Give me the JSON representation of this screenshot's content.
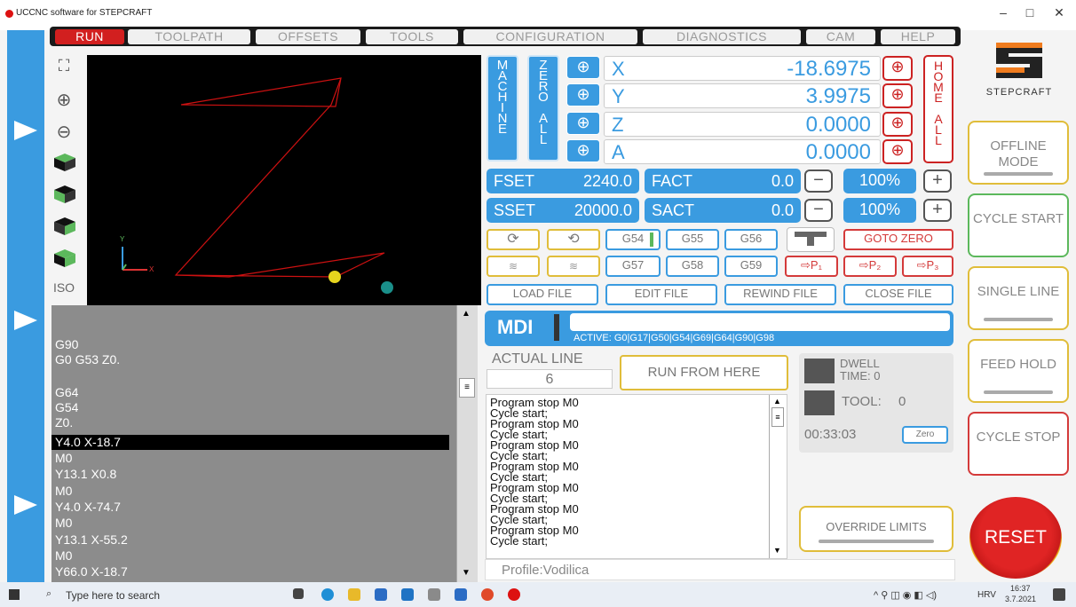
{
  "window": {
    "title": "UCCNC software for STEPCRAFT",
    "min": "–",
    "max": "□",
    "close": "✕"
  },
  "tabs": [
    "RUN",
    "TOOLPATH",
    "OFFSETS",
    "TOOLS",
    "CONFIGURATION",
    "DIAGNOSTICS",
    "CAM",
    "HELP"
  ],
  "view_tools": {
    "fit": "⛶",
    "zoom_in": "⊕",
    "zoom_out": "⊖",
    "iso": "ISO"
  },
  "viewport_axes": {
    "y": "Y",
    "x": "X"
  },
  "gcode": {
    "lines": [
      "",
      "",
      "G90",
      "G0 G53 Z0.",
      "",
      "G64",
      "G54",
      "Z0.",
      "Y4.0 X-18.7",
      "M0",
      "Y13.1 X0.8",
      "M0",
      "Y4.0 X-74.7",
      "M0",
      "Y13.1 X-55.2",
      "M0",
      "Y66.0 X-18.7"
    ],
    "selected_index": 8
  },
  "dro": {
    "machine_label": [
      "M",
      "A",
      "C",
      "H",
      "I",
      "N",
      "E"
    ],
    "zero_all_label": [
      "Z",
      "E",
      "R",
      "O",
      "",
      "A",
      "L",
      "L"
    ],
    "home_all_label": [
      "H",
      "O",
      "M",
      "E",
      "",
      "A",
      "L",
      "L"
    ],
    "axes": [
      {
        "name": "X",
        "value": "-18.6975"
      },
      {
        "name": "Y",
        "value": "3.9975"
      },
      {
        "name": "Z",
        "value": "0.0000"
      },
      {
        "name": "A",
        "value": "0.0000"
      }
    ],
    "plus_symbol": "⊕",
    "home_symbol": "⊕"
  },
  "feed": {
    "fset_label": "FSET",
    "fset_value": "2240.0",
    "fact_label": "FACT",
    "fact_value": "0.0",
    "override": "100%"
  },
  "spindle": {
    "sset_label": "SSET",
    "sset_value": "20000.0",
    "sact_label": "SACT",
    "sact_value": "0.0",
    "override": "100%"
  },
  "minus": "−",
  "plus": "+",
  "offsets": {
    "g54": "G54",
    "g55": "G55",
    "g56": "G56",
    "g57": "G57",
    "g58": "G58",
    "g59": "G59"
  },
  "goto_zero": "GOTO ZERO",
  "positions": {
    "p1": "⇨P₁",
    "p2": "⇨P₂",
    "p3": "⇨P₃"
  },
  "file_buttons": {
    "load": "LOAD FILE",
    "edit": "EDIT FILE",
    "rewind": "REWIND FILE",
    "close": "CLOSE FILE"
  },
  "mdi": {
    "label": "MDI",
    "value": "",
    "active": "ACTIVE: G0|G17|G50|G54|G69|G64|G90|G98"
  },
  "actual_line": {
    "label": "ACTUAL LINE",
    "value": "6"
  },
  "run_from_here": "RUN FROM HERE",
  "dwell": {
    "label": "DWELL",
    "time_label": "TIME:",
    "time_value": "0"
  },
  "tool": {
    "label": "TOOL:",
    "value": "0"
  },
  "timer": {
    "value": "00:33:03",
    "zero": "Zero"
  },
  "log": [
    "Program stop M0",
    "Cycle start;",
    "Program stop M0",
    "Cycle start;",
    "Program stop M0",
    "Cycle start;",
    "Program stop M0",
    "Cycle start;",
    "Program stop M0",
    "Cycle start;",
    "Program stop M0",
    "Cycle start;",
    "Program stop M0",
    "Cycle start;"
  ],
  "profile": "Profile:Vodilica",
  "override_limits": "OVERRIDE LIMITS",
  "right": {
    "brand": "STEPCRAFT",
    "offline": "OFFLINE MODE",
    "cycle_start": "CYCLE START",
    "single_line": "SINGLE LINE",
    "feed_hold": "FEED HOLD",
    "cycle_stop": "CYCLE STOP",
    "reset": "RESET"
  },
  "taskbar": {
    "search": "Type here to search",
    "lang": "HRV",
    "time": "16:37",
    "date": "3.7.2021"
  },
  "colors": {
    "accent": "#3a9be0",
    "danger": "#d21f1f",
    "yellow": "#e0bd3a",
    "green": "#5cb85c"
  }
}
